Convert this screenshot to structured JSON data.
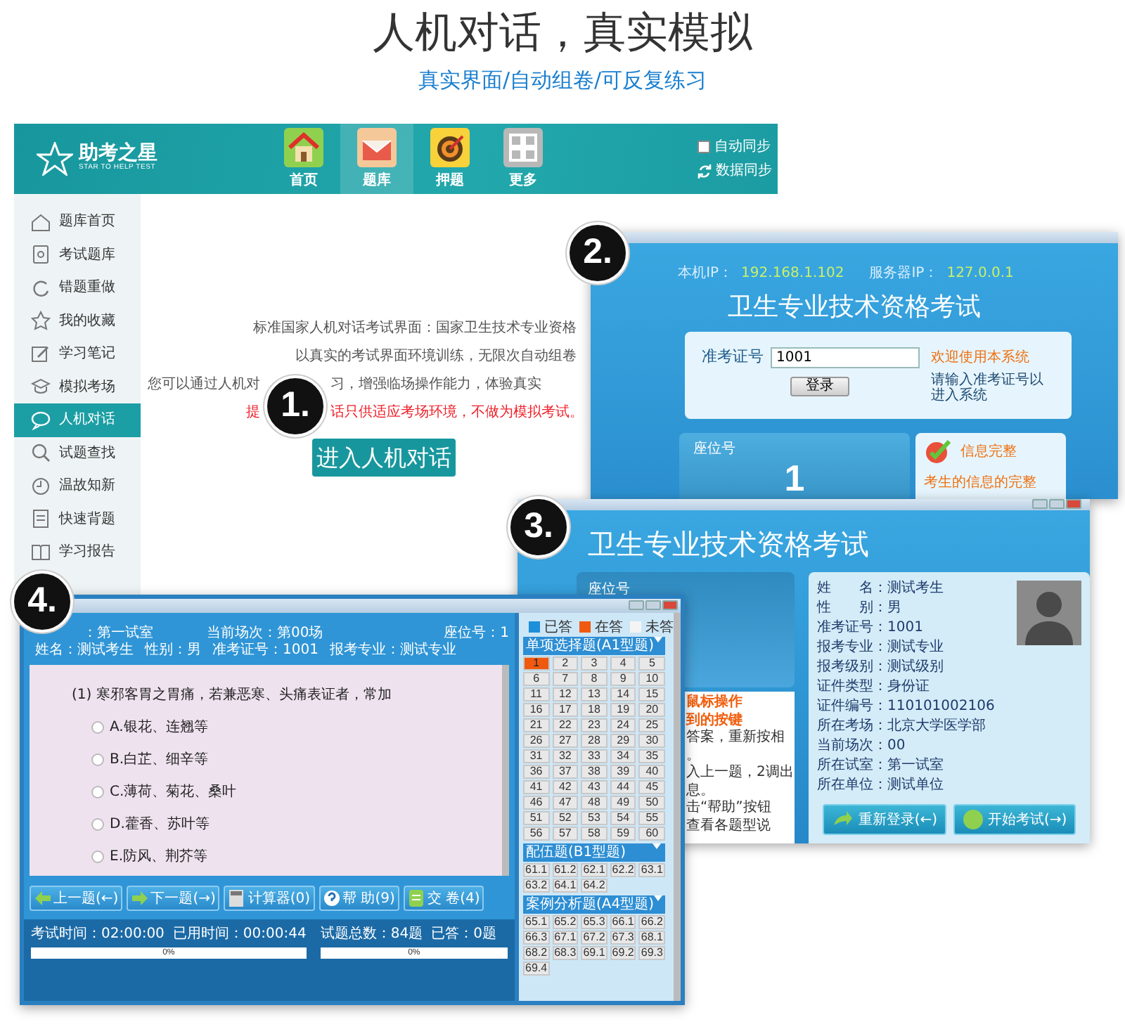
{
  "header": {
    "title": "人机对话，真实模拟",
    "subtitle": "真实界面/自动组卷/可反复练习"
  },
  "app_window": {
    "logo": {
      "name": "助考之星",
      "tagline": "STAR TO HELP TEST"
    },
    "nav": [
      {
        "label": "首页",
        "selected": false
      },
      {
        "label": "题库",
        "selected": true
      },
      {
        "label": "押题",
        "selected": false
      },
      {
        "label": "更多",
        "selected": false
      }
    ],
    "auto_sync": {
      "label": "自动同步",
      "checked": false
    },
    "data_sync": "数据同步",
    "sidebar": [
      {
        "label": "题库首页",
        "selected": false
      },
      {
        "label": "考试题库",
        "selected": false
      },
      {
        "label": "错题重做",
        "selected": false
      },
      {
        "label": "我的收藏",
        "selected": false
      },
      {
        "label": "学习笔记",
        "selected": false
      },
      {
        "label": "模拟考场",
        "selected": false
      },
      {
        "label": "人机对话",
        "selected": true
      },
      {
        "label": "试题查找",
        "selected": false
      },
      {
        "label": "温故知新",
        "selected": false
      },
      {
        "label": "快速背题",
        "selected": false
      },
      {
        "label": "学习报告",
        "selected": false
      }
    ],
    "intro": [
      "标准国家人机对话考试界面：国家卫生技术专业资格",
      "以真实的考试界面环境训练，无限次自动组卷"
    ],
    "intro_split": [
      "您可以通过人机对",
      "习，增强临场操作能力，体验真实"
    ],
    "notice": [
      "提",
      "话只供适应考场环境，不做为模拟考试。"
    ],
    "enter_button": "进入人机对话",
    "badge": "1."
  },
  "login_window": {
    "local_ip_label": "本机IP：",
    "local_ip": "192.168.1.102",
    "server_ip_label": "服务器IP：",
    "server_ip": "127.0.0.1",
    "title": "卫生专业技术资格考试",
    "id_label": "准考证号",
    "id_value": "1001",
    "login_button": "登录",
    "welcome": "欢迎使用本系统",
    "hint": "请输入准考证号以进入系统",
    "seat_label": "座位号",
    "seat_number": "1",
    "status_title": "信息完整",
    "status_text": "考生的信息的完整",
    "badge": "2."
  },
  "info_window": {
    "title": "卫生专业技术资格考试",
    "seat_label": "座位号",
    "instructions": [
      {
        "kind": "heading",
        "text": "鼠标操作"
      },
      {
        "kind": "heading",
        "text": "到的按键"
      },
      {
        "kind": "text",
        "text": "答案，重新按相"
      },
      {
        "kind": "text",
        "text": "。"
      },
      {
        "kind": "text",
        "text": "入上一题，2调出"
      },
      {
        "kind": "text",
        "text": "息。"
      },
      {
        "kind": "text",
        "text": "击“帮助”按钮"
      },
      {
        "kind": "text",
        "text": "查看各题型说"
      }
    ],
    "fields": [
      {
        "label": "姓　　名：",
        "value": "测试考生"
      },
      {
        "label": "性　　别：",
        "value": "男"
      },
      {
        "label": "准考证号：",
        "value": "1001"
      },
      {
        "label": "报考专业：",
        "value": "测试专业"
      },
      {
        "label": "报考级别：",
        "value": "测试级别"
      },
      {
        "label": "证件类型：",
        "value": "身份证"
      },
      {
        "label": "证件编号：",
        "value": "110101002106"
      },
      {
        "label": "所在考场：",
        "value": "北京大学医学部"
      },
      {
        "label": "当前场次：",
        "value": "00"
      },
      {
        "label": "所在试室：",
        "value": "第一试室"
      },
      {
        "label": "所在单位：",
        "value": "测试单位"
      }
    ],
    "buttons": [
      "重新登录(←)",
      "开始考试(→)"
    ],
    "badge": "3."
  },
  "exam_window": {
    "info": [
      [
        "：第一试室",
        "当前场次：第00场",
        "座位号：1"
      ],
      [
        "姓名：测试考生",
        "性别：男",
        "准考证号：1001",
        "报考专业：测试专业"
      ]
    ],
    "question": "(1) 寒邪客胃之胃痛，若兼恶寒、头痛表证者，常加",
    "options": [
      {
        "label": "A.银花、连翘等",
        "selected": false
      },
      {
        "label": "B.白芷、细辛等",
        "selected": false
      },
      {
        "label": "C.薄荷、菊花、桑叶",
        "selected": false
      },
      {
        "label": "D.藿香、苏叶等",
        "selected": false
      },
      {
        "label": "E.防风、荆芥等",
        "selected": false
      }
    ],
    "buttons": [
      "上一题(←)",
      "下一题(→)",
      "计算器(0)",
      "帮 助(9)",
      "交 卷(4)"
    ],
    "exam_time": "考试时间：02:00:00",
    "used_time": "已用时间：00:00:44",
    "total": "试题总数：84题",
    "answered": "已答：0题",
    "time_progress": {
      "level": 0,
      "reading": "0%"
    },
    "answer_progress": {
      "level": 0,
      "reading": "0%"
    },
    "legend": [
      {
        "label": "已答",
        "color": "#1e8fd8"
      },
      {
        "label": "在答",
        "color": "#f05a10"
      },
      {
        "label": "未答",
        "color": "#f4f4f4"
      }
    ],
    "sections": [
      {
        "title": "单项选择题(A1型题)",
        "items": [
          {
            "label": "1",
            "selected": true
          },
          {
            "label": "2",
            "selected": false
          },
          {
            "label": "3",
            "selected": false
          },
          {
            "label": "4",
            "selected": false
          },
          {
            "label": "5",
            "selected": false
          },
          {
            "label": "6",
            "selected": false
          },
          {
            "label": "7",
            "selected": false
          },
          {
            "label": "8",
            "selected": false
          },
          {
            "label": "9",
            "selected": false
          },
          {
            "label": "10",
            "selected": false
          },
          {
            "label": "11",
            "selected": false
          },
          {
            "label": "12",
            "selected": false
          },
          {
            "label": "13",
            "selected": false
          },
          {
            "label": "14",
            "selected": false
          },
          {
            "label": "15",
            "selected": false
          },
          {
            "label": "16",
            "selected": false
          },
          {
            "label": "17",
            "selected": false
          },
          {
            "label": "18",
            "selected": false
          },
          {
            "label": "19",
            "selected": false
          },
          {
            "label": "20",
            "selected": false
          },
          {
            "label": "21",
            "selected": false
          },
          {
            "label": "22",
            "selected": false
          },
          {
            "label": "23",
            "selected": false
          },
          {
            "label": "24",
            "selected": false
          },
          {
            "label": "25",
            "selected": false
          },
          {
            "label": "26",
            "selected": false
          },
          {
            "label": "27",
            "selected": false
          },
          {
            "label": "28",
            "selected": false
          },
          {
            "label": "29",
            "selected": false
          },
          {
            "label": "30",
            "selected": false
          },
          {
            "label": "31",
            "selected": false
          },
          {
            "label": "32",
            "selected": false
          },
          {
            "label": "33",
            "selected": false
          },
          {
            "label": "34",
            "selected": false
          },
          {
            "label": "35",
            "selected": false
          },
          {
            "label": "36",
            "selected": false
          },
          {
            "label": "37",
            "selected": false
          },
          {
            "label": "38",
            "selected": false
          },
          {
            "label": "39",
            "selected": false
          },
          {
            "label": "40",
            "selected": false
          },
          {
            "label": "41",
            "selected": false
          },
          {
            "label": "42",
            "selected": false
          },
          {
            "label": "43",
            "selected": false
          },
          {
            "label": "44",
            "selected": false
          },
          {
            "label": "45",
            "selected": false
          },
          {
            "label": "46",
            "selected": false
          },
          {
            "label": "47",
            "selected": false
          },
          {
            "label": "48",
            "selected": false
          },
          {
            "label": "49",
            "selected": false
          },
          {
            "label": "50",
            "selected": false
          },
          {
            "label": "51",
            "selected": false
          },
          {
            "label": "52",
            "selected": false
          },
          {
            "label": "53",
            "selected": false
          },
          {
            "label": "54",
            "selected": false
          },
          {
            "label": "55",
            "selected": false
          },
          {
            "label": "56",
            "selected": false
          },
          {
            "label": "57",
            "selected": false
          },
          {
            "label": "58",
            "selected": false
          },
          {
            "label": "59",
            "selected": false
          },
          {
            "label": "60",
            "selected": false
          }
        ]
      },
      {
        "title": "配伍题(B1型题)",
        "items": [
          {
            "label": "61.1",
            "selected": false
          },
          {
            "label": "61.2",
            "selected": false
          },
          {
            "label": "62.1",
            "selected": false
          },
          {
            "label": "62.2",
            "selected": false
          },
          {
            "label": "63.1",
            "selected": false
          },
          {
            "label": "63.2",
            "selected": false
          },
          {
            "label": "64.1",
            "selected": false
          },
          {
            "label": "64.2",
            "selected": false
          }
        ]
      },
      {
        "title": "案例分析题(A4型题)",
        "items": [
          {
            "label": "65.1",
            "selected": false
          },
          {
            "label": "65.2",
            "selected": false
          },
          {
            "label": "65.3",
            "selected": false
          },
          {
            "label": "66.1",
            "selected": false
          },
          {
            "label": "66.2",
            "selected": false
          },
          {
            "label": "66.3",
            "selected": false
          },
          {
            "label": "67.1",
            "selected": false
          },
          {
            "label": "67.2",
            "selected": false
          },
          {
            "label": "67.3",
            "selected": false
          },
          {
            "label": "68.1",
            "selected": false
          },
          {
            "label": "68.2",
            "selected": false
          },
          {
            "label": "68.3",
            "selected": false
          },
          {
            "label": "69.1",
            "selected": false
          },
          {
            "label": "69.2",
            "selected": false
          },
          {
            "label": "69.3",
            "selected": false
          },
          {
            "label": "69.4",
            "selected": false
          }
        ]
      }
    ],
    "badge": "4."
  }
}
